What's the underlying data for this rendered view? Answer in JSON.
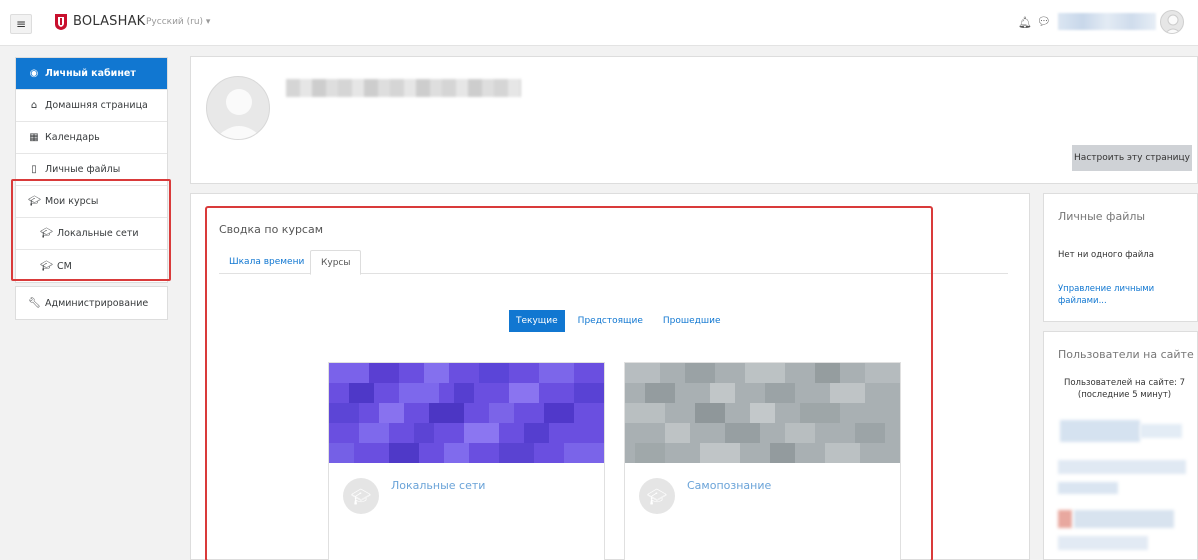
{
  "navbar": {
    "menu_icon": "hamburger-icon",
    "brand": "BOLASHAK",
    "language": "Русский (ru) ▾",
    "notification_icon": "bell-icon",
    "message_icon": "chat-icon"
  },
  "leftnav": {
    "items": [
      {
        "label": "Личный кабинет",
        "icon": "dashboard-icon"
      },
      {
        "label": "Домашняя страница",
        "icon": "home-icon"
      },
      {
        "label": "Календарь",
        "icon": "calendar-icon"
      },
      {
        "label": "Личные файлы",
        "icon": "file-icon"
      },
      {
        "label": "Мои курсы",
        "icon": "graduation-cap-icon"
      },
      {
        "label": "Локальные сети",
        "icon": "graduation-cap-icon"
      },
      {
        "label": "СМ",
        "icon": "graduation-cap-icon"
      }
    ],
    "admin": {
      "label": "Администрирование",
      "icon": "wrench-icon"
    }
  },
  "header": {
    "customize_label": "Настроить эту страницу"
  },
  "overview": {
    "title": "Сводка по курсам",
    "tabs": [
      "Шкала времени",
      "Курсы"
    ],
    "filters": [
      "Текущие",
      "Предстоящие",
      "Прошедшие"
    ],
    "courses": [
      {
        "name": "Локальные сети",
        "color": "#6a4fe0"
      },
      {
        "name": "Самопознание",
        "color": "#a9b0b3"
      }
    ]
  },
  "right": {
    "files_title": "Личные файлы",
    "files_empty": "Нет ни одного файла",
    "files_link": "Управление личными файлами...",
    "users_title": "Пользователи на сайте",
    "users_text": "Пользователей на сайте: 7 (последние 5 минут)"
  }
}
